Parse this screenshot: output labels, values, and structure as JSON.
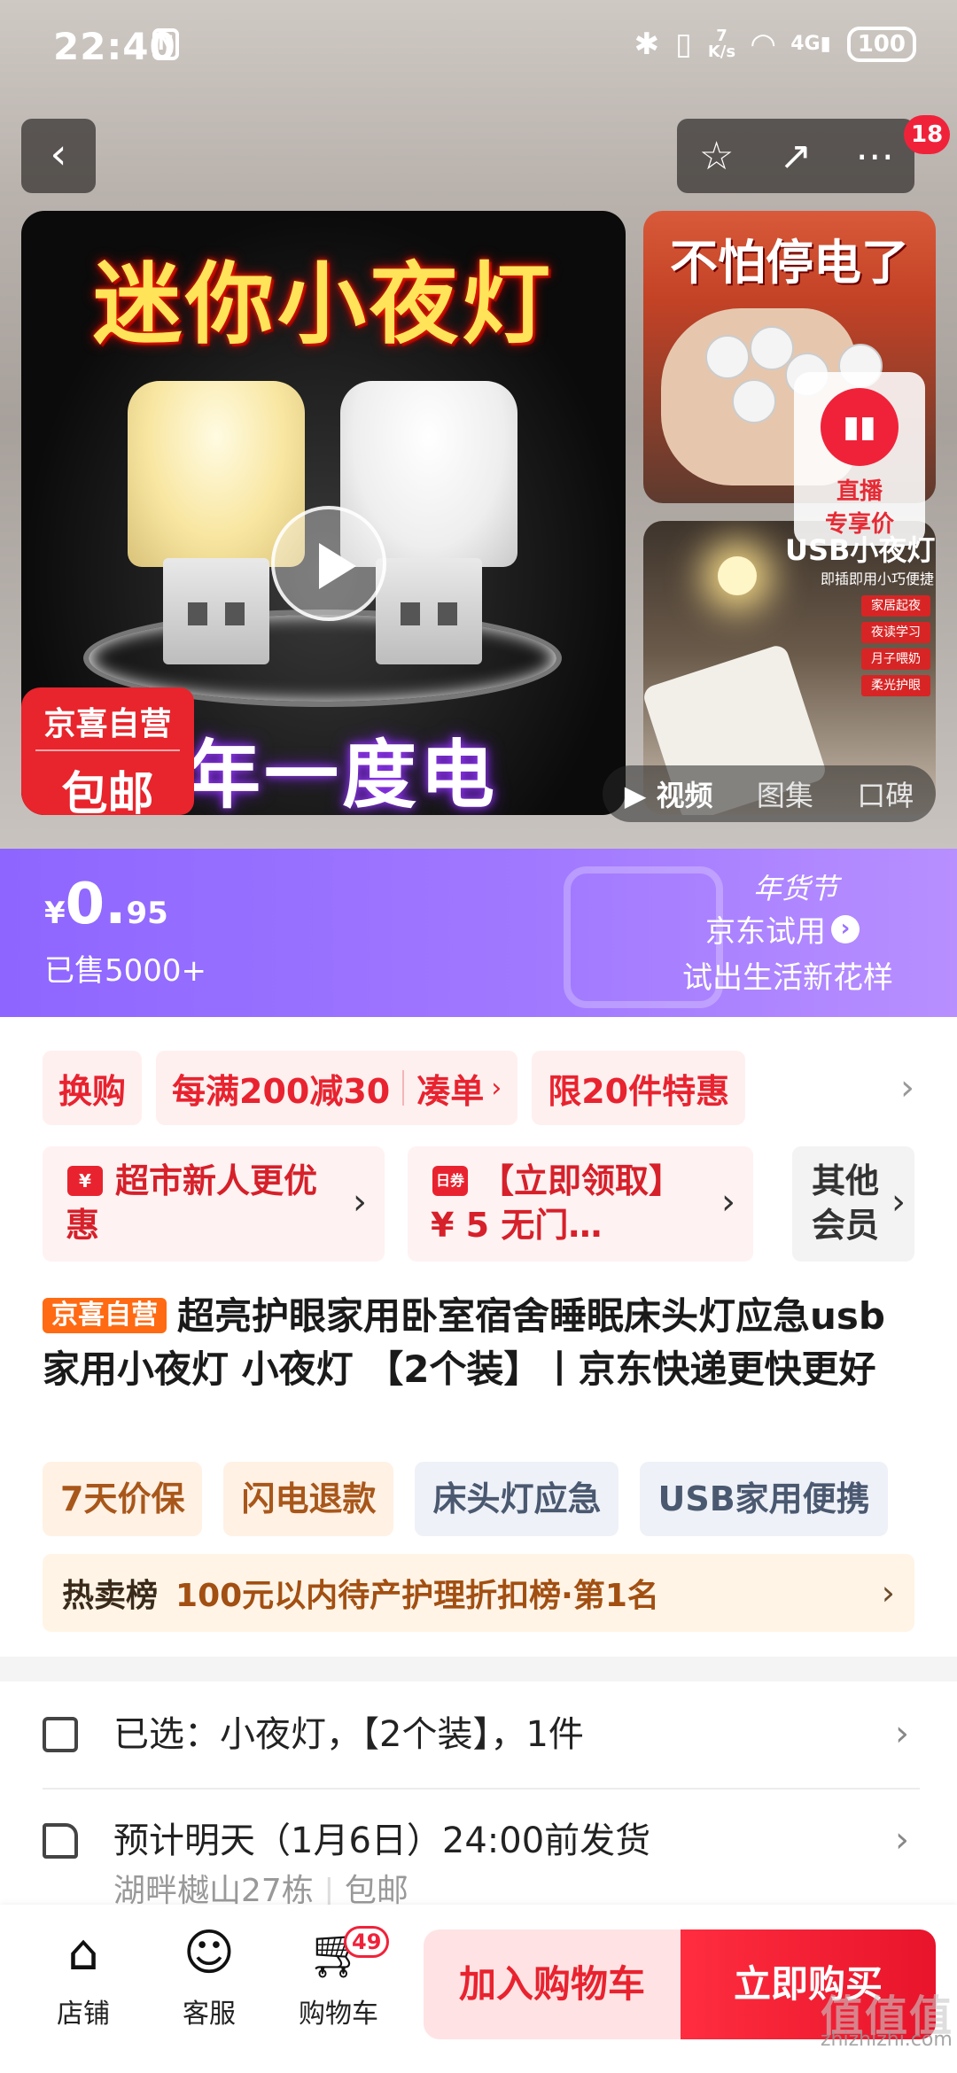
{
  "status_bar": {
    "time": "22:40",
    "nfc": "N",
    "net_speed": "7\nK/s",
    "signal": "4G",
    "battery": "100"
  },
  "nav": {
    "back_icon": "back-chevron-icon",
    "favorite_icon": "star-icon",
    "share_icon": "share-icon",
    "more_icon": "more-icon",
    "message_badge": "18"
  },
  "gallery": {
    "main_headline": "迷你小夜灯",
    "main_bottom_text": "年一度电",
    "main_badge_line1": "京喜自营",
    "main_badge_line2": "包邮",
    "thumb1_caption": "不怕停电了",
    "thumb2_caption": "USB小夜灯",
    "thumb2_sub": "即插即用小巧便捷",
    "thumb2_features": [
      "家居起夜",
      "夜读学习",
      "月子喂奶",
      "柔光护眼"
    ],
    "live_line1": "直播",
    "live_line2": "专享价",
    "tabs": [
      "视频",
      "图集",
      "口碑"
    ],
    "active_tab": "视频"
  },
  "price": {
    "currency": "¥",
    "integer": "0.",
    "decimal": "95",
    "sold": "已售5000+",
    "festival": "年货节",
    "trial": "京东试用",
    "slogan": "试出生活新花样"
  },
  "promotions": {
    "chip1": "换购",
    "chip2_main": "每满200减30",
    "chip2_action": "凑单",
    "chip3": "限20件特惠"
  },
  "coupons": {
    "c1": "超市新人更优惠",
    "c1_icon": "¥",
    "c2": "【立即领取】¥ 5 无门…",
    "c2_icon": "日券",
    "c3": "其他会员"
  },
  "product": {
    "store_tag": "京喜自营",
    "title": "超亮护眼家用卧室宿舍睡眠床头灯应急usb家用小夜灯 小夜灯 【2个装】丨京东快递更快更好",
    "tags": [
      {
        "label": "7天价保",
        "style": "orange"
      },
      {
        "label": "闪电退款",
        "style": "orange"
      },
      {
        "label": "床头灯应急",
        "style": "blue"
      },
      {
        "label": "USB家用便携",
        "style": "blue"
      }
    ],
    "rank_label": "热卖榜",
    "rank_text": "100元以内待产护理折扣榜·第1名"
  },
  "selection": {
    "selected": "已选：小夜灯，【2个装】，1件",
    "delivery": "预计明天（1月6日）24:00前发货",
    "address": "湖畔樾山27栋",
    "shipping": "包邮"
  },
  "bottom_bar": {
    "store": "店铺",
    "service": "客服",
    "cart": "购物车",
    "cart_count": "49",
    "add_to_cart": "加入购物车",
    "buy_now": "立即购买"
  },
  "watermark": {
    "big": "值值值",
    "small": "zhizhizhi.com"
  }
}
